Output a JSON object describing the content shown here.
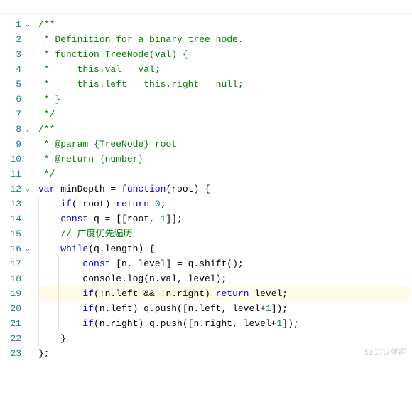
{
  "lines": [
    {
      "n": 1,
      "fold": "v",
      "tokens": [
        [
          "cm",
          "/**"
        ]
      ]
    },
    {
      "n": 2,
      "tokens": [
        [
          "cm",
          " * Definition for a binary tree node."
        ]
      ]
    },
    {
      "n": 3,
      "tokens": [
        [
          "cm",
          " * function TreeNode(val) {"
        ]
      ]
    },
    {
      "n": 4,
      "tokens": [
        [
          "cm",
          " *     this.val = val;"
        ]
      ]
    },
    {
      "n": 5,
      "tokens": [
        [
          "cm",
          " *     this.left = this.right = null;"
        ]
      ]
    },
    {
      "n": 6,
      "tokens": [
        [
          "cm",
          " * }"
        ]
      ]
    },
    {
      "n": 7,
      "tokens": [
        [
          "cm",
          " */"
        ]
      ]
    },
    {
      "n": 8,
      "fold": "v",
      "tokens": [
        [
          "cm",
          "/**"
        ]
      ]
    },
    {
      "n": 9,
      "tokens": [
        [
          "cm",
          " * @param {TreeNode} root"
        ]
      ]
    },
    {
      "n": 10,
      "tokens": [
        [
          "cm",
          " * @return {number}"
        ]
      ]
    },
    {
      "n": 11,
      "tokens": [
        [
          "cm",
          " */"
        ]
      ]
    },
    {
      "n": 12,
      "fold": "v",
      "tokens": [
        [
          "kw",
          "var"
        ],
        [
          "pn",
          " minDepth = "
        ],
        [
          "fn",
          "function"
        ],
        [
          "pn",
          "(root) {"
        ]
      ]
    },
    {
      "n": 13,
      "guides": [
        1
      ],
      "tokens": [
        [
          "pn",
          "    "
        ],
        [
          "kw",
          "if"
        ],
        [
          "pn",
          "(!root) "
        ],
        [
          "kw",
          "return"
        ],
        [
          "pn",
          " "
        ],
        [
          "num",
          "0"
        ],
        [
          "pn",
          ";"
        ]
      ]
    },
    {
      "n": 14,
      "guides": [
        1
      ],
      "tokens": [
        [
          "pn",
          "    "
        ],
        [
          "kw",
          "const"
        ],
        [
          "pn",
          " q = [[root, "
        ],
        [
          "num",
          "1"
        ],
        [
          "pn",
          "]];"
        ]
      ]
    },
    {
      "n": 15,
      "guides": [
        1
      ],
      "tokens": [
        [
          "pn",
          "    "
        ],
        [
          "cm",
          "// 广度优先遍历"
        ]
      ]
    },
    {
      "n": 16,
      "fold": "v",
      "guides": [
        1
      ],
      "tokens": [
        [
          "pn",
          "    "
        ],
        [
          "kw",
          "while"
        ],
        [
          "pn",
          "(q.length) {"
        ]
      ]
    },
    {
      "n": 17,
      "guides": [
        1,
        2
      ],
      "tokens": [
        [
          "pn",
          "        "
        ],
        [
          "kw",
          "const"
        ],
        [
          "pn",
          " [n, level] = q.shift();"
        ]
      ]
    },
    {
      "n": 18,
      "guides": [
        1,
        2
      ],
      "tokens": [
        [
          "pn",
          "        console.log(n.val, level);"
        ]
      ]
    },
    {
      "n": 19,
      "hl": true,
      "guides": [
        1,
        2
      ],
      "tokens": [
        [
          "pn",
          "        "
        ],
        [
          "kw",
          "if"
        ],
        [
          "pn",
          "(!n.left && !n.right) "
        ],
        [
          "kw",
          "return"
        ],
        [
          "pn",
          " level;"
        ]
      ]
    },
    {
      "n": 20,
      "guides": [
        1,
        2
      ],
      "tokens": [
        [
          "pn",
          "        "
        ],
        [
          "kw",
          "if"
        ],
        [
          "pn",
          "(n.left) q.push([n.left, level+"
        ],
        [
          "num",
          "1"
        ],
        [
          "pn",
          "]);"
        ]
      ]
    },
    {
      "n": 21,
      "guides": [
        1,
        2
      ],
      "tokens": [
        [
          "pn",
          "        "
        ],
        [
          "kw",
          "if"
        ],
        [
          "pn",
          "(n.right) q.push([n.right, level+"
        ],
        [
          "num",
          "1"
        ],
        [
          "pn",
          "]);"
        ]
      ]
    },
    {
      "n": 22,
      "guides": [
        1
      ],
      "tokens": [
        [
          "pn",
          "    }"
        ]
      ]
    },
    {
      "n": 23,
      "tokens": [
        [
          "pn",
          "};"
        ]
      ]
    }
  ],
  "watermark": "51CTO博客"
}
